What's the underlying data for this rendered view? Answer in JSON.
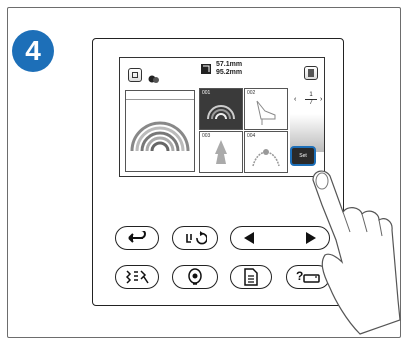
{
  "step": {
    "number": "4"
  },
  "lcd": {
    "size_width": "57.1mm",
    "size_height": "95.2mm",
    "page_top": "1",
    "page_bottom": "7",
    "thumbnails": [
      {
        "number": "001"
      },
      {
        "number": "002"
      },
      {
        "number": "003"
      },
      {
        "number": "004"
      }
    ],
    "set_label": "Set"
  },
  "buttons": {
    "back": "back-arrow-icon",
    "needle": "needle-position-icon",
    "prev_next": "prev-next-arrows-icon",
    "stitch": "stitch-pattern-icon",
    "embroidery": "embroidery-icon",
    "file": "file-icon",
    "help": "help-icon"
  },
  "colors": {
    "accent": "#1d6fb8"
  }
}
